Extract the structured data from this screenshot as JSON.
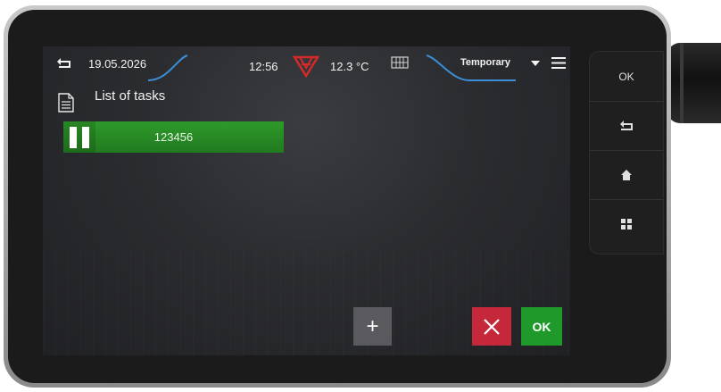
{
  "header": {
    "date": "19.05.2026",
    "time": "12:56",
    "temperature": "12.3 °C",
    "mode": "Temporary"
  },
  "page": {
    "title": "List of tasks"
  },
  "tasks": [
    {
      "name": "123456",
      "status": "running"
    }
  ],
  "side_buttons": {
    "ok_label": "OK"
  },
  "actions": {
    "ok_label": "OK"
  },
  "colors": {
    "accent_blue": "#3a8fd8",
    "task_green": "#2e9a2a",
    "cancel_red": "#c4283a",
    "ok_green": "#1f9a2a",
    "brand_red": "#d42a2a"
  },
  "icons": [
    "back-arrow-icon",
    "brand-logo-icon",
    "connectivity-icon",
    "dropdown-arrow-icon",
    "menu-icon",
    "document-icon",
    "pause-icon",
    "plus-icon",
    "close-icon",
    "return-icon",
    "home-icon",
    "grid-icon"
  ]
}
